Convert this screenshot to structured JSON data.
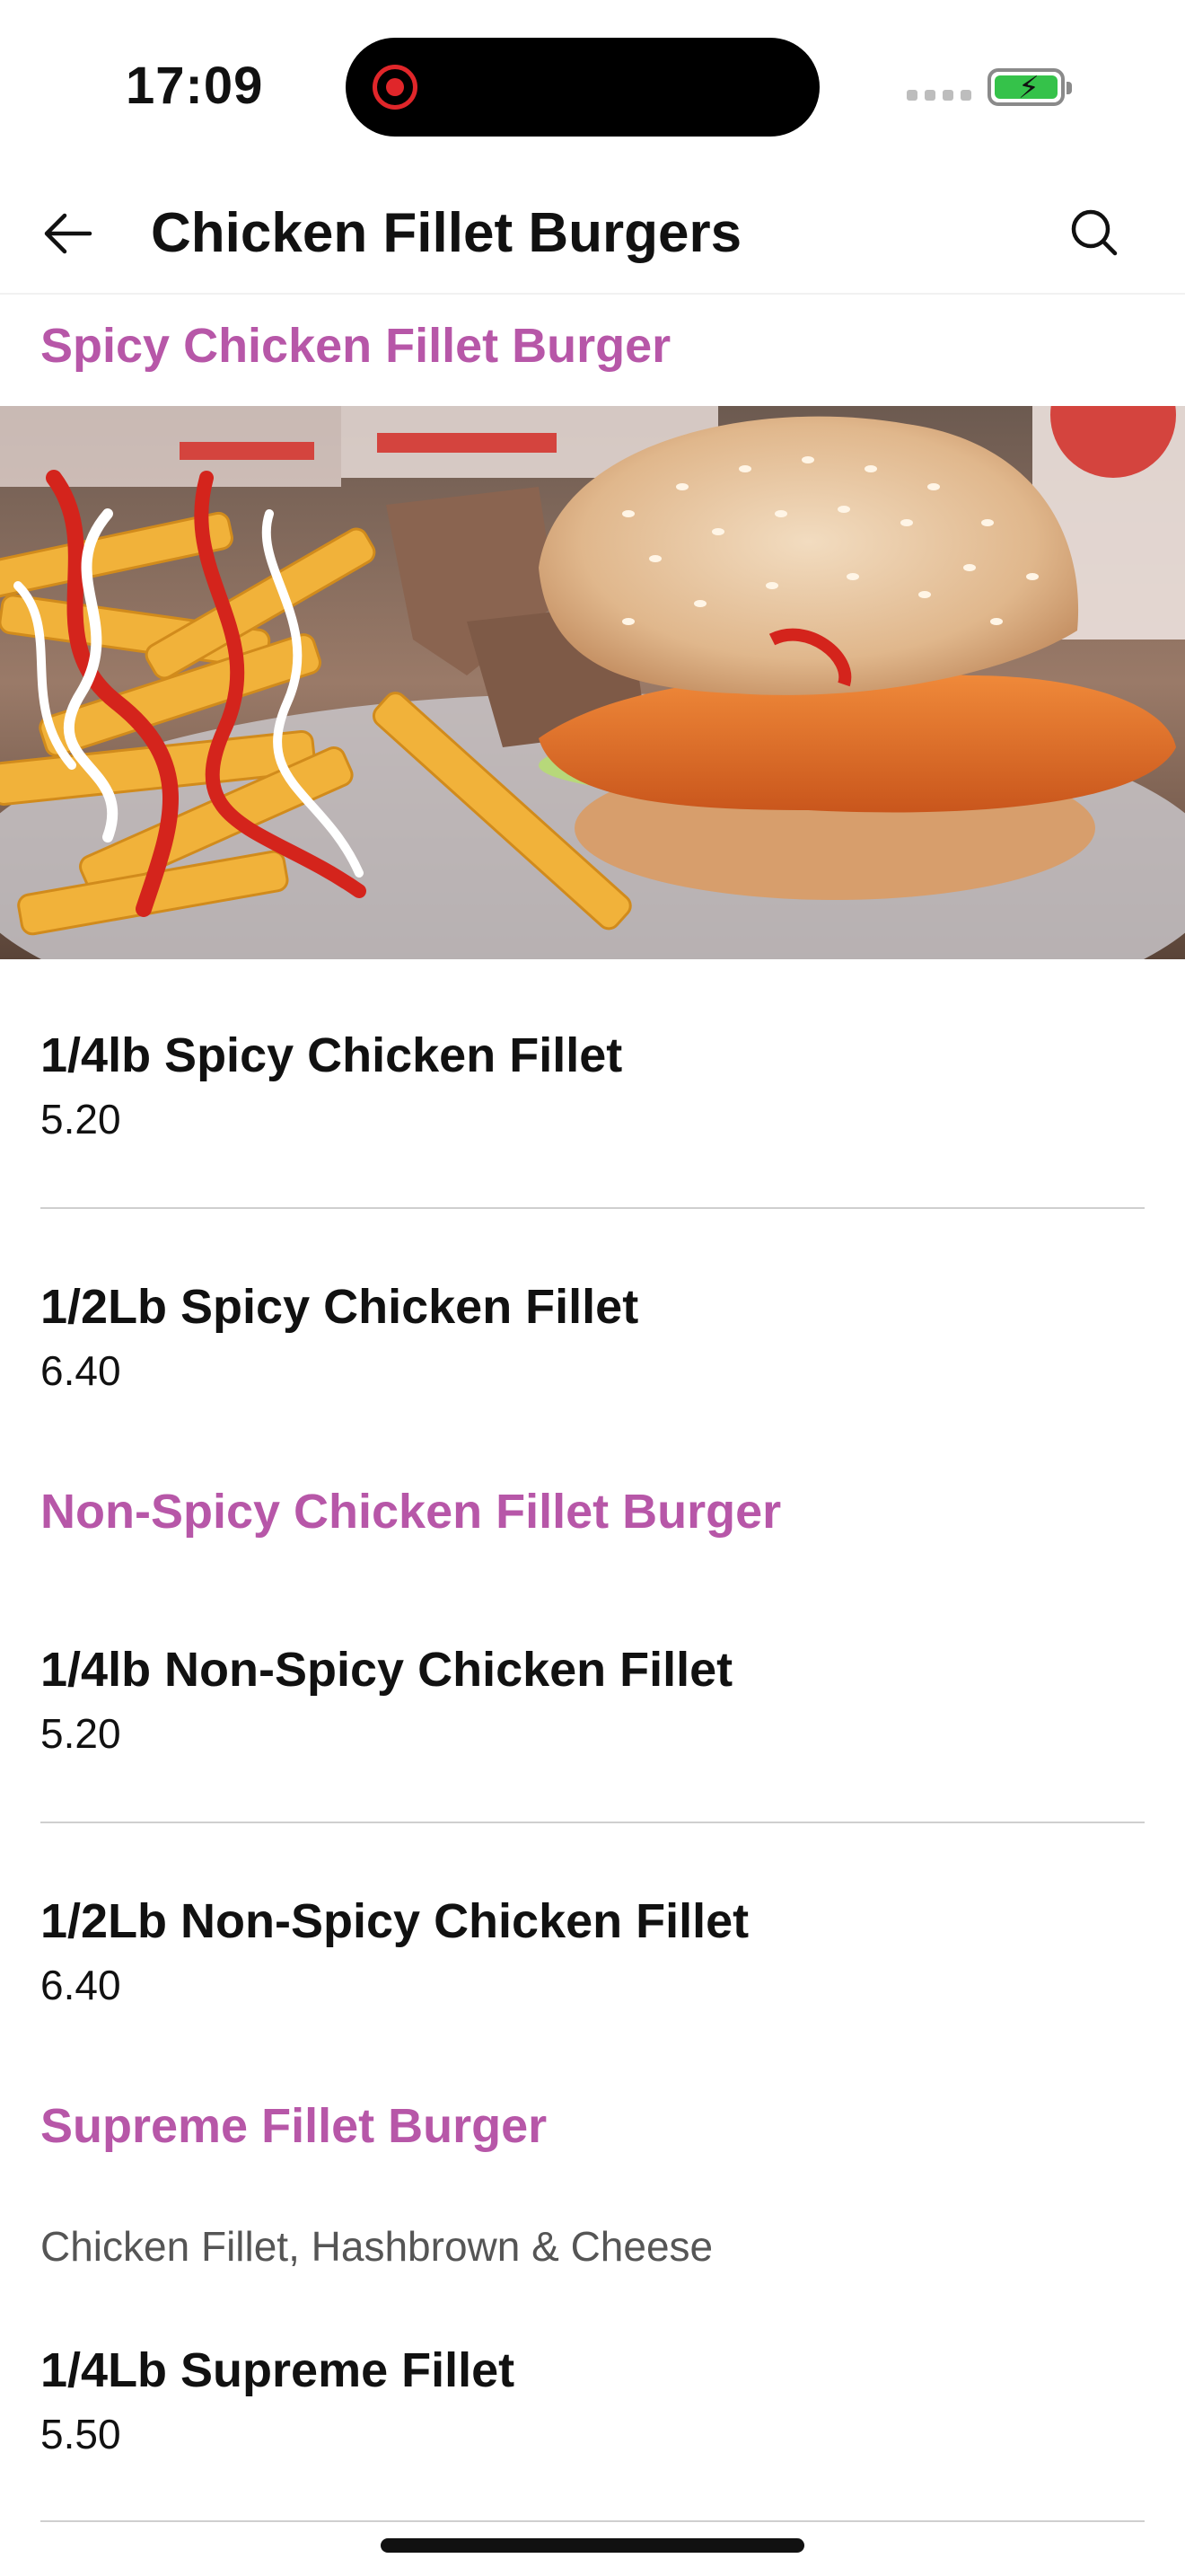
{
  "status_bar": {
    "time": "17:09"
  },
  "header": {
    "title": "Chicken Fillet Burgers"
  },
  "sections": [
    {
      "title": "Spicy Chicken Fillet Burger",
      "items": [
        {
          "name": "1/4lb Spicy Chicken Fillet",
          "price": "5.20"
        },
        {
          "name": "1/2Lb Spicy Chicken Fillet",
          "price": "6.40"
        }
      ]
    },
    {
      "title": "Non-Spicy Chicken Fillet Burger",
      "items": [
        {
          "name": "1/4lb Non-Spicy Chicken Fillet",
          "price": "5.20"
        },
        {
          "name": "1/2Lb Non-Spicy Chicken Fillet",
          "price": "6.40"
        }
      ]
    },
    {
      "title": "Supreme Fillet Burger",
      "description": "Chicken Fillet, Hashbrown & Cheese",
      "items": [
        {
          "name": "1/4Lb Supreme Fillet",
          "price": "5.50"
        }
      ]
    }
  ],
  "icons": {
    "back": "arrow-left-icon",
    "search": "search-icon",
    "record": "record-icon",
    "battery": "battery-charging-icon"
  },
  "colors": {
    "accent": "#b757a8",
    "text": "#111111",
    "muted": "#555555",
    "divider": "#cfcfcf"
  }
}
